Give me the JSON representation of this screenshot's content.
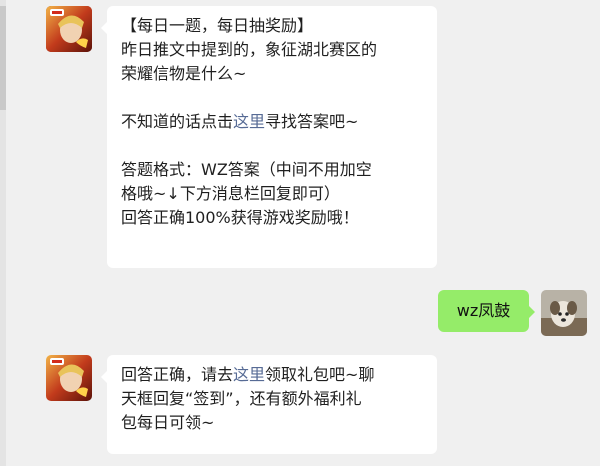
{
  "messages": [
    {
      "sender": "bot",
      "lines": [
        {
          "text": "【每日一题，每日抽奖励】"
        },
        {
          "text": "昨日推文中提到的，象征湖北赛区的"
        },
        {
          "text": "荣耀信物是什么~"
        },
        {
          "text": ""
        },
        {
          "pre": "不知道的话点击",
          "link": "这里",
          "post": "寻找答案吧~"
        },
        {
          "text": ""
        },
        {
          "text": "答题格式：WZ答案（中间不用加空"
        },
        {
          "text": "格哦~↓下方消息栏回复即可）"
        },
        {
          "text": "回答正确100%获得游戏奖励哦！"
        }
      ]
    },
    {
      "sender": "user",
      "text": "wz凤鼓"
    },
    {
      "sender": "bot",
      "lines": [
        {
          "pre": "回答正确，请去",
          "link": "这里",
          "post": "领取礼包吧~聊"
        },
        {
          "text": "天框回复“签到”，还有额外福利礼"
        },
        {
          "text": "包每日可领~"
        }
      ]
    }
  ],
  "colors": {
    "background": "#f0f0f0",
    "bubble_bot": "#ffffff",
    "bubble_user": "#95ec69",
    "link": "#576b95"
  },
  "icons": {
    "bot_avatar": "game-character-avatar-icon",
    "user_avatar": "dog-photo-avatar-icon"
  }
}
